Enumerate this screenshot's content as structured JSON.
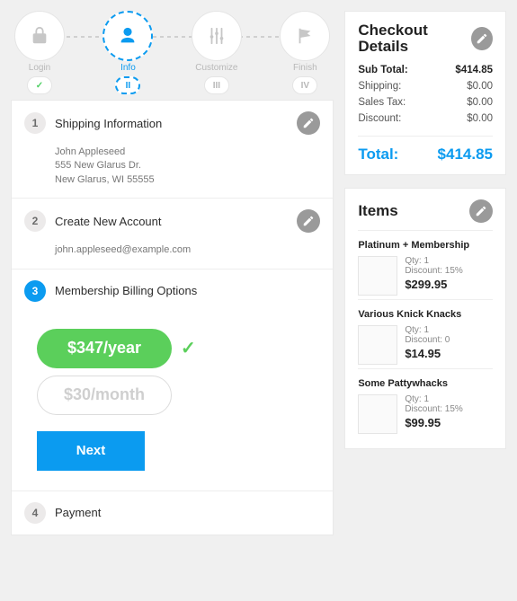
{
  "steps": [
    {
      "label": "Login",
      "badge": "✓"
    },
    {
      "label": "Info",
      "badge": "II"
    },
    {
      "label": "Customize",
      "badge": "III"
    },
    {
      "label": "Finish",
      "badge": "IV"
    }
  ],
  "sections": {
    "shipping": {
      "num": "1",
      "title": "Shipping Information",
      "name": "John Appleseed",
      "addr1": "555 New Glarus Dr.",
      "addr2": "New Glarus, WI 55555"
    },
    "account": {
      "num": "2",
      "title": "Create New Account",
      "email": "john.appleseed@example.com"
    },
    "billing": {
      "num": "3",
      "title": "Membership Billing Options",
      "option_year": "$347/year",
      "option_month": "$30/month",
      "next": "Next"
    },
    "payment": {
      "num": "4",
      "title": "Payment"
    }
  },
  "checkout": {
    "title": "Checkout Details",
    "subtotal_label": "Sub Total:",
    "subtotal": "$414.85",
    "shipping_label": "Shipping:",
    "shipping": "$0.00",
    "tax_label": "Sales Tax:",
    "tax": "$0.00",
    "discount_label": "Discount:",
    "discount": "$0.00",
    "total_label": "Total:",
    "total": "$414.85"
  },
  "items_title": "Items",
  "items": [
    {
      "name": "Platinum + Membership",
      "qty": "Qty: 1",
      "disc": "Discount: 15%",
      "price": "$299.95"
    },
    {
      "name": "Various Knick Knacks",
      "qty": "Qty: 1",
      "disc": "Discount: 0",
      "price": "$14.95"
    },
    {
      "name": "Some Pattywhacks",
      "qty": "Qty: 1",
      "disc": "Discount: 15%",
      "price": "$99.95"
    }
  ]
}
